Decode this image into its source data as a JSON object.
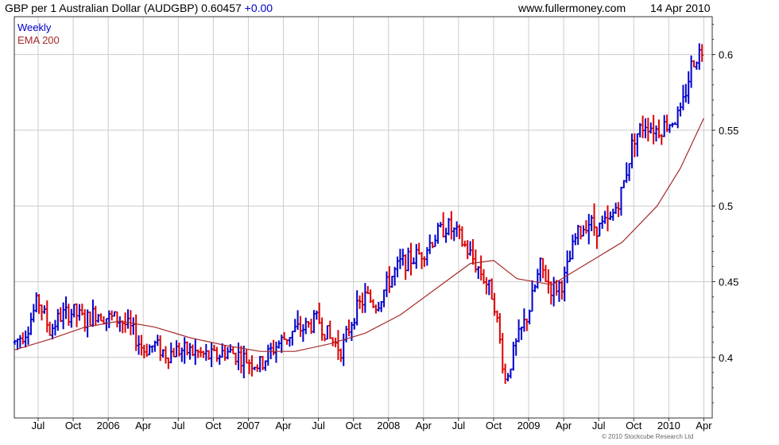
{
  "header": {
    "symbol_text": "GBP per 1 Australian Dollar (AUDGBP)",
    "last_price": "0.60457",
    "change": "+0.00",
    "website": "www.fullermoney.com",
    "date": "14 Apr 2010"
  },
  "legend": {
    "series1": "Weekly",
    "series2": "EMA 200"
  },
  "copyright": "© 2010 Stockcube Research Ltd",
  "colors": {
    "up": "#0000cc",
    "down": "#dd0000",
    "ema": "#a52a2a",
    "grid": "#cccccc"
  },
  "chart_data": {
    "type": "line",
    "title": "GBP per 1 Australian Dollar (AUDGBP)",
    "xlabel": "",
    "ylabel": "",
    "ylim": [
      0.36,
      0.625
    ],
    "y_ticks": [
      0.4,
      0.45,
      0.5,
      0.55,
      0.6
    ],
    "y_tick_labels": [
      "0.4",
      "0.45",
      "0.5",
      "0.55",
      "0.6"
    ],
    "x_tick_labels": [
      "Jul",
      "Oct",
      "2006",
      "Apr",
      "Jul",
      "Oct",
      "2007",
      "Apr",
      "Jul",
      "Oct",
      "2008",
      "Apr",
      "Jul",
      "Oct",
      "2009",
      "Apr",
      "Jul",
      "Oct",
      "2010",
      "Apr"
    ],
    "grid": true,
    "legend_position": "top-left",
    "series": [
      {
        "name": "Weekly",
        "style": "OHLC bars (blue up, red down)",
        "points": [
          [
            "2005-05",
            0.41
          ],
          [
            "2005-06",
            0.418
          ],
          [
            "2005-07",
            0.438
          ],
          [
            "2005-08",
            0.418
          ],
          [
            "2005-09",
            0.428
          ],
          [
            "2005-10",
            0.43
          ],
          [
            "2005-11",
            0.424
          ],
          [
            "2005-12",
            0.43
          ],
          [
            "2006-01",
            0.426
          ],
          [
            "2006-02",
            0.425
          ],
          [
            "2006-03",
            0.418
          ],
          [
            "2006-04",
            0.405
          ],
          [
            "2006-05",
            0.408
          ],
          [
            "2006-06",
            0.402
          ],
          [
            "2006-07",
            0.405
          ],
          [
            "2006-08",
            0.404
          ],
          [
            "2006-09",
            0.402
          ],
          [
            "2006-10",
            0.4
          ],
          [
            "2006-11",
            0.404
          ],
          [
            "2006-12",
            0.402
          ],
          [
            "2007-01",
            0.398
          ],
          [
            "2007-02",
            0.395
          ],
          [
            "2007-03",
            0.405
          ],
          [
            "2007-04",
            0.412
          ],
          [
            "2007-05",
            0.418
          ],
          [
            "2007-06",
            0.42
          ],
          [
            "2007-07",
            0.425
          ],
          [
            "2007-08",
            0.412
          ],
          [
            "2007-09",
            0.405
          ],
          [
            "2007-10",
            0.428
          ],
          [
            "2007-11",
            0.44
          ],
          [
            "2007-12",
            0.435
          ],
          [
            "2008-01",
            0.45
          ],
          [
            "2008-02",
            0.462
          ],
          [
            "2008-03",
            0.465
          ],
          [
            "2008-04",
            0.47
          ],
          [
            "2008-05",
            0.48
          ],
          [
            "2008-06",
            0.487
          ],
          [
            "2008-07",
            0.48
          ],
          [
            "2008-08",
            0.468
          ],
          [
            "2008-09",
            0.455
          ],
          [
            "2008-10",
            0.44
          ],
          [
            "2008-11",
            0.385
          ],
          [
            "2008-12",
            0.41
          ],
          [
            "2009-01",
            0.43
          ],
          [
            "2009-02",
            0.46
          ],
          [
            "2009-03",
            0.445
          ],
          [
            "2009-04",
            0.45
          ],
          [
            "2009-05",
            0.478
          ],
          [
            "2009-06",
            0.49
          ],
          [
            "2009-07",
            0.485
          ],
          [
            "2009-08",
            0.49
          ],
          [
            "2009-09",
            0.51
          ],
          [
            "2009-10",
            0.545
          ],
          [
            "2009-11",
            0.555
          ],
          [
            "2009-12",
            0.55
          ],
          [
            "2010-01",
            0.555
          ],
          [
            "2010-02",
            0.56
          ],
          [
            "2010-03",
            0.595
          ],
          [
            "2010-04",
            0.605
          ]
        ]
      },
      {
        "name": "EMA 200",
        "points": [
          [
            "2005-05",
            0.405
          ],
          [
            "2005-08",
            0.412
          ],
          [
            "2005-11",
            0.42
          ],
          [
            "2006-02",
            0.424
          ],
          [
            "2006-05",
            0.42
          ],
          [
            "2006-08",
            0.413
          ],
          [
            "2006-11",
            0.408
          ],
          [
            "2007-02",
            0.404
          ],
          [
            "2007-05",
            0.404
          ],
          [
            "2007-08",
            0.409
          ],
          [
            "2007-11",
            0.416
          ],
          [
            "2008-02",
            0.428
          ],
          [
            "2008-05",
            0.445
          ],
          [
            "2008-08",
            0.462
          ],
          [
            "2008-10",
            0.464
          ],
          [
            "2008-12",
            0.452
          ],
          [
            "2009-03",
            0.448
          ],
          [
            "2009-06",
            0.462
          ],
          [
            "2009-09",
            0.476
          ],
          [
            "2009-12",
            0.5
          ],
          [
            "2010-02",
            0.525
          ],
          [
            "2010-04",
            0.558
          ]
        ]
      }
    ]
  }
}
